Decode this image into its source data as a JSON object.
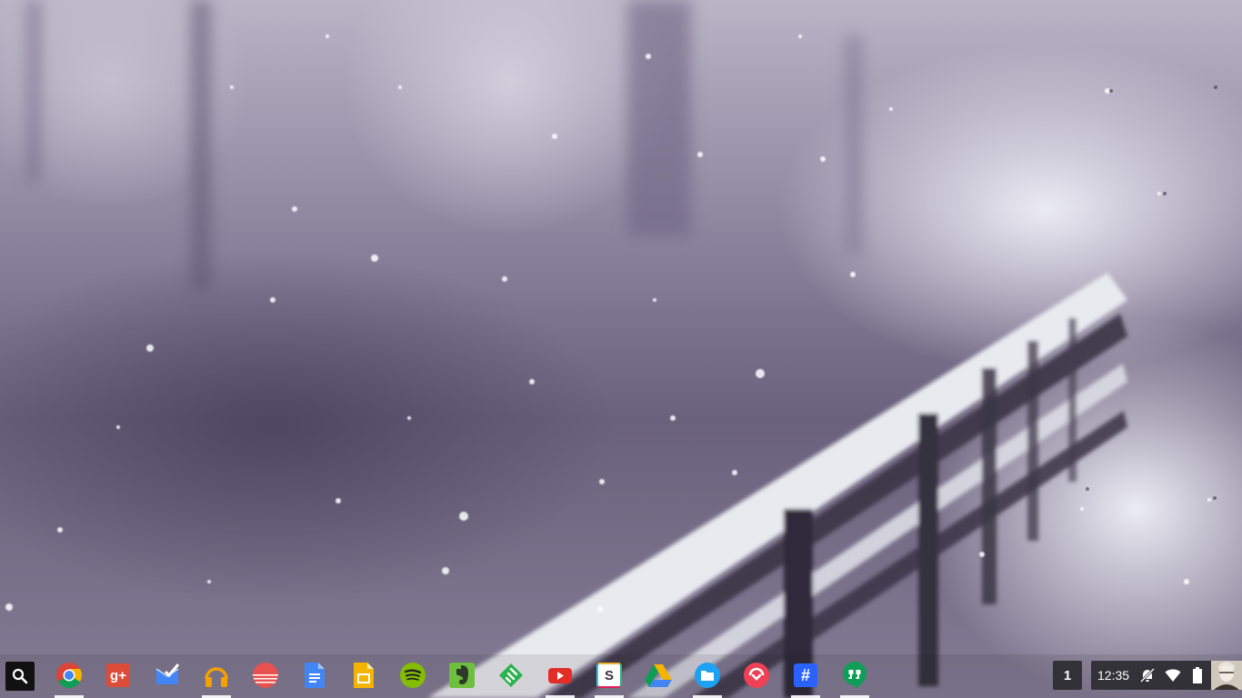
{
  "desktop": {
    "wallpaper": "snow-covered-railing-wallpaper"
  },
  "shelf": {
    "launcher": {
      "icon": "search-icon"
    },
    "apps": [
      {
        "name": "chrome",
        "icon": "chrome-icon",
        "color": "#DB4437",
        "running": true
      },
      {
        "name": "google-plus",
        "icon": "google-plus-icon",
        "color": "#DD4B39",
        "label": "g+",
        "running": false
      },
      {
        "name": "inbox",
        "icon": "inbox-icon",
        "color": "#4285F4",
        "running": false
      },
      {
        "name": "music",
        "icon": "headphones-icon",
        "color": "#F4A100",
        "running": true
      },
      {
        "name": "sunrise",
        "icon": "sunrise-icon",
        "color": "#E9514E",
        "running": false
      },
      {
        "name": "docs",
        "icon": "docs-icon",
        "color": "#4285F4",
        "running": false
      },
      {
        "name": "slides",
        "icon": "slides-icon",
        "color": "#F4B400",
        "running": false
      },
      {
        "name": "spotify",
        "icon": "spotify-icon",
        "color": "#84BD00",
        "running": false
      },
      {
        "name": "evernote",
        "icon": "evernote-icon",
        "color": "#6FBF3E",
        "running": false
      },
      {
        "name": "feedly",
        "icon": "feedly-icon",
        "color": "#2BB24C",
        "running": false
      },
      {
        "name": "youtube",
        "icon": "youtube-icon",
        "color": "#E52D27",
        "running": true
      },
      {
        "name": "slack",
        "icon": "slack-icon",
        "color": "#ECB22E",
        "label": "S",
        "running": true
      },
      {
        "name": "drive",
        "icon": "drive-icon",
        "color": "#0F9D58",
        "running": false
      },
      {
        "name": "files",
        "icon": "folder-icon",
        "color": "#1DA1F2",
        "running": true
      },
      {
        "name": "pocket",
        "icon": "pocket-icon",
        "color": "#EF4056",
        "running": false
      },
      {
        "name": "hashtag-app",
        "icon": "hashtag-icon",
        "color": "#2962FF",
        "label": "#",
        "running": true
      },
      {
        "name": "hangouts",
        "icon": "hangouts-icon",
        "color": "#0F9D58",
        "running": true
      }
    ]
  },
  "status": {
    "desk_count": "1",
    "time": "12:35",
    "icons": [
      "notifications-off-icon",
      "wifi-icon",
      "battery-icon"
    ],
    "avatar": "user-avatar"
  }
}
